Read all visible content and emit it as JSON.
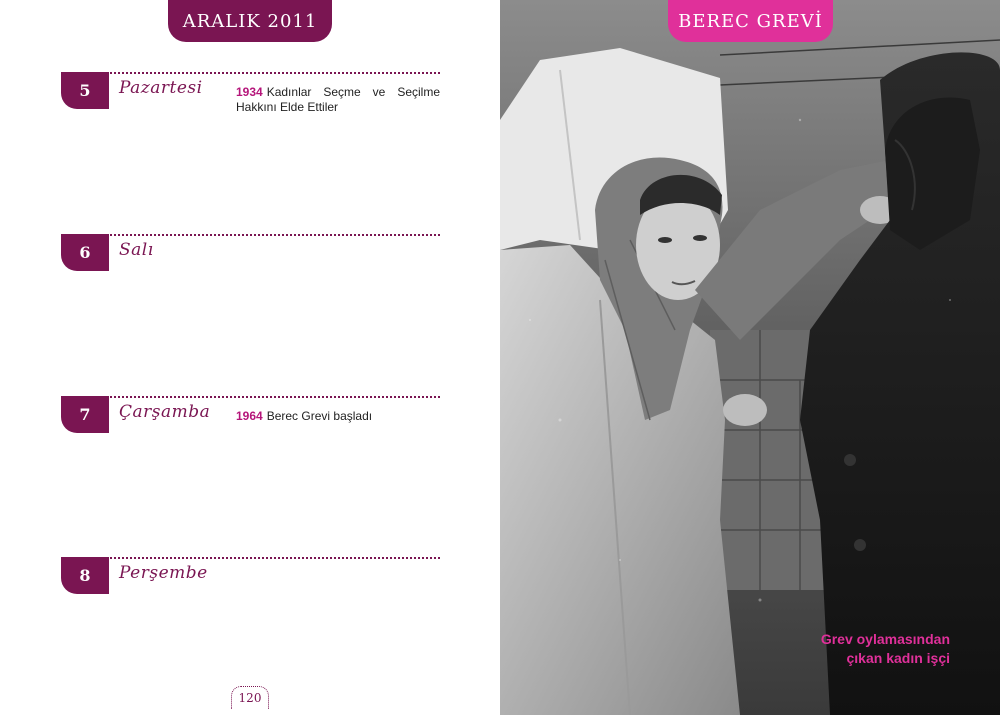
{
  "left_page": {
    "header": "ARALIK 2011",
    "days": [
      {
        "num": "5",
        "name": "Pazartesi",
        "event_year": "1934",
        "event_text": "Kadınlar Seçme ve Seçilme Hakkını Elde Ettiler"
      },
      {
        "num": "6",
        "name": "Salı",
        "event_year": "",
        "event_text": ""
      },
      {
        "num": "7",
        "name": "Çarşamba",
        "event_year": "1964",
        "event_text": "Berec Grevi başladı"
      },
      {
        "num": "8",
        "name": "Perşembe",
        "event_year": "",
        "event_text": ""
      }
    ],
    "page_number": "120"
  },
  "right_page": {
    "header": "BEREC GREVİ",
    "caption_line1": "Grev oylamasından",
    "caption_line2": "çıkan kadın işçi"
  },
  "colors": {
    "accent_dark": "#7a1552",
    "accent_pink": "#e0309a"
  }
}
